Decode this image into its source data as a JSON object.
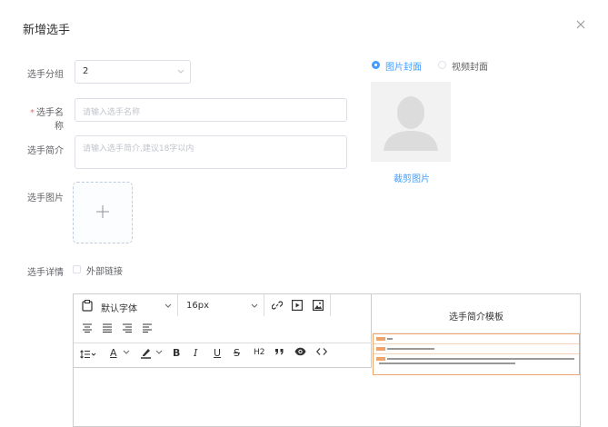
{
  "dialog": {
    "title": "新增选手"
  },
  "form": {
    "group": {
      "label": "选手分组",
      "value": "2"
    },
    "name": {
      "label": "选手名称",
      "required_mark": "*",
      "placeholder": "请输入选手名称"
    },
    "intro": {
      "label": "选手简介",
      "placeholder": "请输入选手简介,建议18字以内"
    },
    "image": {
      "label": "选手图片"
    },
    "detail": {
      "label": "选手详情",
      "external_link_label": "外部链接"
    }
  },
  "cover": {
    "options": [
      "图片封面",
      "视频封面"
    ],
    "selected": "图片封面",
    "crop_label": "裁剪图片"
  },
  "editor": {
    "font_family": "默认字体",
    "font_size": "16px",
    "h2_label": "H2",
    "template_title": "选手简介模板"
  },
  "colors": {
    "accent": "#409eff",
    "required": "#f56c6c",
    "template_orange": "#f0a46b"
  }
}
